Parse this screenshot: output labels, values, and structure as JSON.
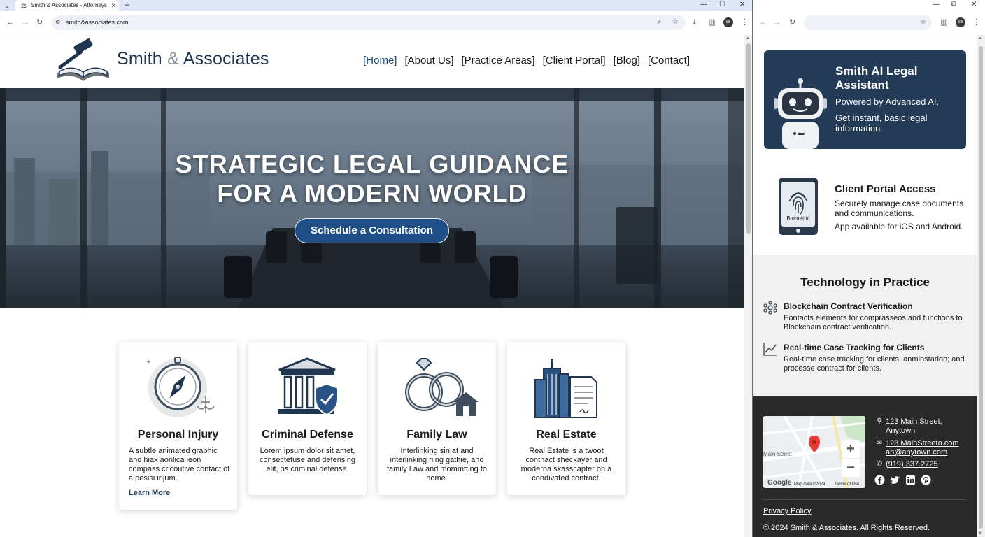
{
  "left_browser": {
    "tab_title": "Smith & Associates - Attorneys",
    "url": "smith&associates.com",
    "profile_initials": "SB"
  },
  "right_browser": {
    "profile_initials": "SB"
  },
  "site": {
    "logo_name": "Smith",
    "logo_amp": "&",
    "logo_rest": "Associates",
    "nav": [
      "[Home]",
      "[About Us]",
      "[Practice Areas]",
      "[Client Portal]",
      "[Blog]",
      "[Contact]"
    ],
    "hero": {
      "title_line1": "STRATEGIC LEGAL GUIDANCE",
      "title_line2": "FOR A MODERN WORLD",
      "cta": "Schedule a Consultation"
    },
    "cards": [
      {
        "title": "Personal Injury",
        "desc": "A subtle animated graphic and hiax aonlica ieon compass cricoutive contact of a pesisi injum.",
        "link": "Learn More",
        "icon": "compass-icon"
      },
      {
        "title": "Criminal Defense",
        "desc": "Lorem ipsum dolor sit amet, consectetuse and defensing elit, os criminal defense.",
        "icon": "courthouse-shield-icon"
      },
      {
        "title": "Family Law",
        "desc": "Interlinking sinıat and interlinking riing gathie, and family Law and mommtting to home.",
        "icon": "rings-house-icon"
      },
      {
        "title": "Real Estate",
        "desc": "Real Estate is a twoot contnact sheckayer and moderna skasscapter on a condivated contract.",
        "icon": "building-document-icon"
      }
    ]
  },
  "sidebar": {
    "ai": {
      "title": "Smith AI Legal Assistant",
      "subtitle": "Powered by Advanced AI.",
      "desc": "Get instant, basic legal information."
    },
    "portal": {
      "phone_label": "Blometric",
      "title": "Client Portal Access",
      "desc": "Securely manage case documents and communications.",
      "app": "App available for iOS and Android."
    },
    "tech": {
      "title": "Technology in Practice",
      "items": [
        {
          "title": "Blockchain Contract Verification",
          "desc": "Eontacts elements for comprasseos and functions to Blockchain contract verification.",
          "icon": "blockchain-icon"
        },
        {
          "title": "Real-time Case Tracking for Clients",
          "desc": "Real-time case tracking for clients, anminstarion; and processe contract for clients.",
          "icon": "trend-chart-icon"
        }
      ]
    },
    "footer": {
      "map_street": "Main Street",
      "map_google": "Google",
      "map_data": "Map data ©2024",
      "map_terms": "Terms of Use",
      "address": "123 Main Street, Anytown",
      "email": "123 MainStreeto.com an@anytown.com",
      "phone": "(919) 337.2725",
      "privacy": "Privacy Policy",
      "copyright": "© 2024 Smith & Associates. All Rights Reserved."
    }
  },
  "colors": {
    "brand_navy": "#1f3550",
    "cta_blue": "#1f4f86",
    "ai_card": "#243b57",
    "footer_bg": "#2a2a2a"
  }
}
